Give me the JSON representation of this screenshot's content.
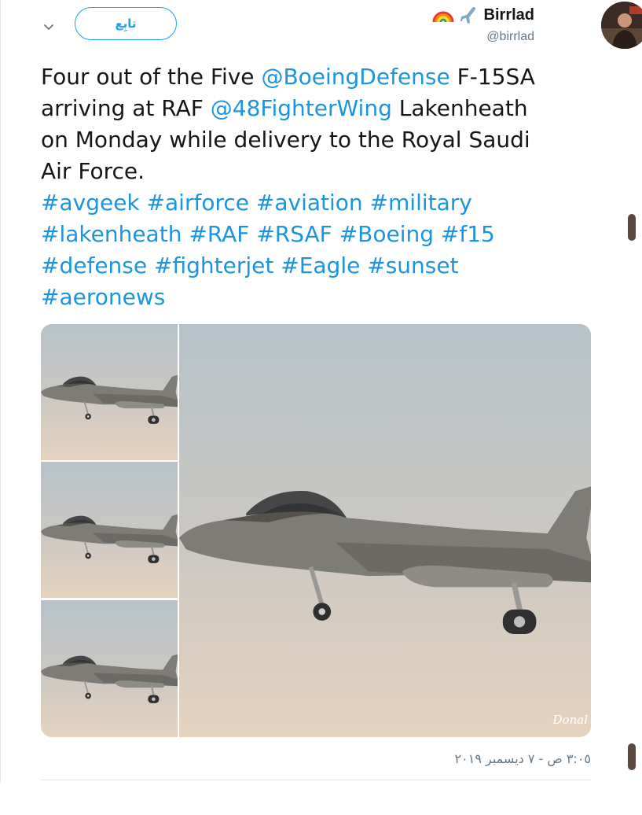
{
  "header": {
    "follow_label": "تابِع",
    "display_name": "Birrlad",
    "name_icons": [
      "rainbow-icon",
      "airplane-icon"
    ],
    "handle": "@birrlad"
  },
  "tweet": {
    "line1_pre": "Four out of the Five ",
    "mention1": "@BoeingDefense",
    "line1_post": " F-15SA",
    "line2_pre": "arriving at RAF ",
    "mention2": "@48FighterWing",
    "line2_post": " Lakenheath",
    "line3": "on Monday while delivery to the Royal Saudi",
    "line4": "Air Force.",
    "hashtags": [
      "#avgeek",
      "#airforce",
      "#aviation",
      "#military",
      "#lakenheath",
      "#RAF",
      "#RSAF",
      "#Boeing",
      "#f15",
      "#defense",
      "#fighterjet",
      "#Eagle",
      "#sunset",
      "#aeronews"
    ],
    "watermark": "Donal",
    "timestamp": "٣:٠٥ ص - ٧ ديسمبر ٢٠١٩"
  },
  "colors": {
    "link": "#1b95e0",
    "follow": "#1da1f2",
    "muted": "#657786",
    "sky_top": "#b7c1c6",
    "sky_bottom": "#e3d2bf"
  }
}
